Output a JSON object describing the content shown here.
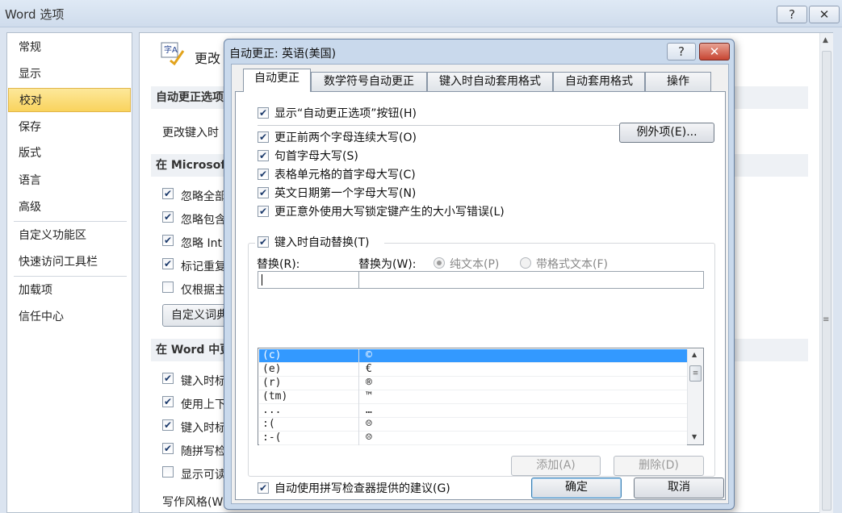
{
  "outer": {
    "title": "Word 选项",
    "help": "?",
    "close": "✕"
  },
  "nav": {
    "items": [
      "常规",
      "显示",
      "校对",
      "保存",
      "版式",
      "语言",
      "高级",
      "自定义功能区",
      "快速访问工具栏",
      "加载项",
      "信任中心"
    ],
    "selected": "校对"
  },
  "content": {
    "header_partial": "更改",
    "section1": "自动更正选项",
    "row1": "更改键入时",
    "section2": "在 Microsof",
    "opts1": [
      "忽略全部",
      "忽略包含",
      "忽略 Int",
      "标记重复",
      "仅根据主"
    ],
    "opts1_checked": [
      true,
      true,
      true,
      true,
      false
    ],
    "custom_dict_btn": "自定义词典",
    "section3": "在 Word 中更",
    "opts2": [
      "键入时标",
      "使用上下",
      "键入时标",
      "随拼写检",
      "显示可读"
    ],
    "opts2_checked": [
      true,
      true,
      true,
      true,
      false
    ],
    "style_label": "写作风格(W"
  },
  "dialog": {
    "title": "自动更正: 英语(美国)",
    "help": "?",
    "close": "✕",
    "tabs": [
      "自动更正",
      "数学符号自动更正",
      "键入时自动套用格式",
      "自动套用格式",
      "操作"
    ],
    "active_tab": "自动更正",
    "show_options": "显示“自动更正选项”按钮(H)",
    "options": [
      "更正前两个字母连续大写(O)",
      "句首字母大写(S)",
      "表格单元格的首字母大写(C)",
      "英文日期第一个字母大写(N)",
      "更正意外使用大写锁定键产生的大小写错误(L)"
    ],
    "exceptions_btn": "例外项(E)...",
    "replace_as_typed": "键入时自动替换(T)",
    "replace_label": "替换(R):",
    "with_label": "替换为(W):",
    "plain_text": "纯文本(P)",
    "formatted_text": "带格式文本(F)",
    "entries": [
      {
        "from": "(c)",
        "to": "©"
      },
      {
        "from": "(e)",
        "to": "€"
      },
      {
        "from": "(r)",
        "to": "®"
      },
      {
        "from": "(tm)",
        "to": "™"
      },
      {
        "from": "...",
        "to": "…"
      },
      {
        "from": ":(",
        "to": "☹"
      },
      {
        "from": ":-(",
        "to": "☹"
      }
    ],
    "add_btn": "添加(A)",
    "delete_btn": "删除(D)",
    "spell_suggest": "自动使用拼写检查器提供的建议(G)",
    "ok": "确定",
    "cancel": "取消"
  },
  "colors": {
    "selection": "#3399ff",
    "nav_selected": "#f9d35d",
    "close_red": "#c74532"
  }
}
